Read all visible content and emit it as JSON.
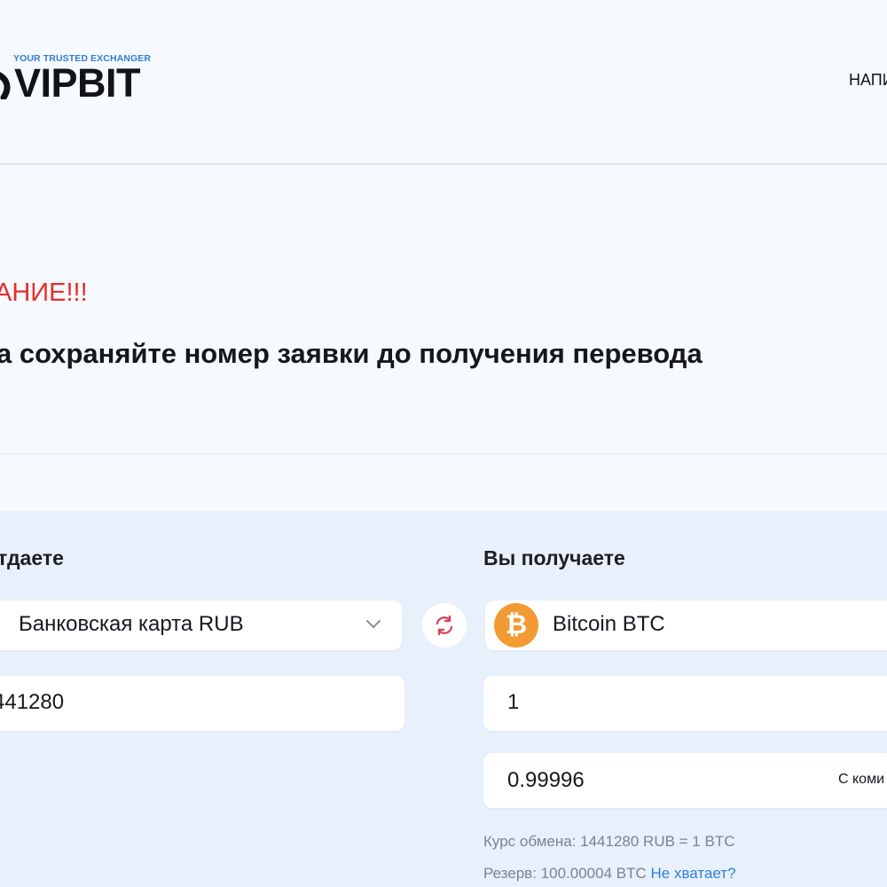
{
  "header": {
    "tagline": "YOUR TRUSTED EXCHANGER",
    "brand": "VIPBIT",
    "nav_link": "НАПИ"
  },
  "notice": {
    "title": "АНИЕ!!!",
    "text": "а сохраняйте номер заявки до получения перевода"
  },
  "exchange": {
    "give": {
      "heading": "тдаете",
      "currency": "Банковская карта RUB",
      "amount": "441280"
    },
    "receive": {
      "heading": "Вы получаете",
      "currency": "Bitcoin BTC",
      "currency_icon": "bitcoin-icon",
      "amount": "1",
      "amount_with_fee": "0.99996",
      "fee_label": "С коми"
    },
    "rate_line": "Курс обмена: 1441280 RUB = 1 BTC",
    "reserve_text": "Резерв: 100.00004 BTC",
    "reserve_link": "Не хватает?"
  },
  "colors": {
    "accent": "#2f7fd6",
    "warning": "#e3302b",
    "bitcoin": "#f29a33",
    "panel_bg": "#e8f0fc",
    "swap_icon": "#d8455b"
  }
}
